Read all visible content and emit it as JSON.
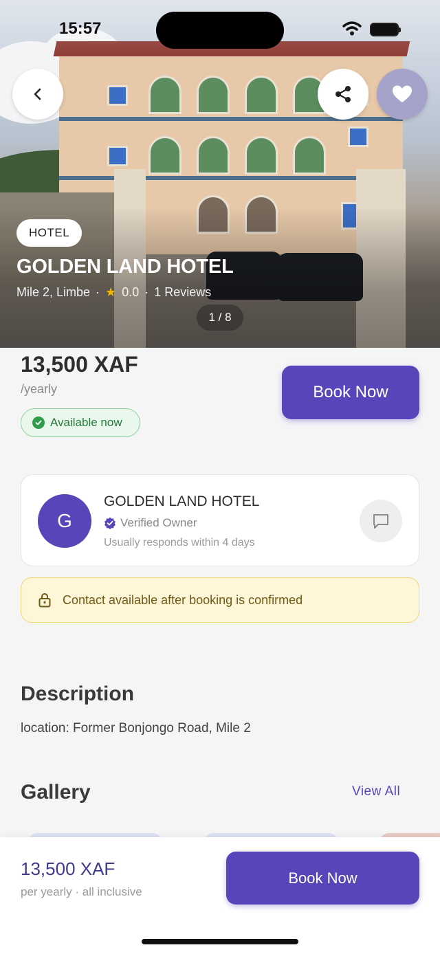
{
  "status_bar": {
    "time": "15:57"
  },
  "hero": {
    "property_type": "HOTEL",
    "name": "GOLDEN LAND HOTEL",
    "location": "Mile 2, Limbe",
    "rating": "0.0",
    "reviews": "1 Reviews",
    "image_counter": "1 / 8",
    "icons": {
      "back": "chevron-left-icon",
      "share": "share-icon",
      "favorite": "heart-icon"
    }
  },
  "pricing": {
    "price": "13,500 XAF",
    "period": "/yearly",
    "availability": "Available now",
    "book_label": "Book Now"
  },
  "owner": {
    "initial": "G",
    "name": "GOLDEN LAND HOTEL",
    "verified_label": "Verified Owner",
    "response_time": "Usually responds within 4 days"
  },
  "contact_note": "Contact available after booking is confirmed",
  "description": {
    "title": "Description",
    "text": "location: Former Bonjongo Road, Mile 2"
  },
  "gallery": {
    "title": "Gallery",
    "view_all": "View All"
  },
  "bottom_bar": {
    "price": "13,500 XAF",
    "subtitle": "per yearly · all inclusive",
    "book_label": "Book Now"
  },
  "colors": {
    "accent": "#5845b9",
    "available_green": "#2e9c4a",
    "note_yellow": "#fdf6d9",
    "star": "#f5b700"
  }
}
